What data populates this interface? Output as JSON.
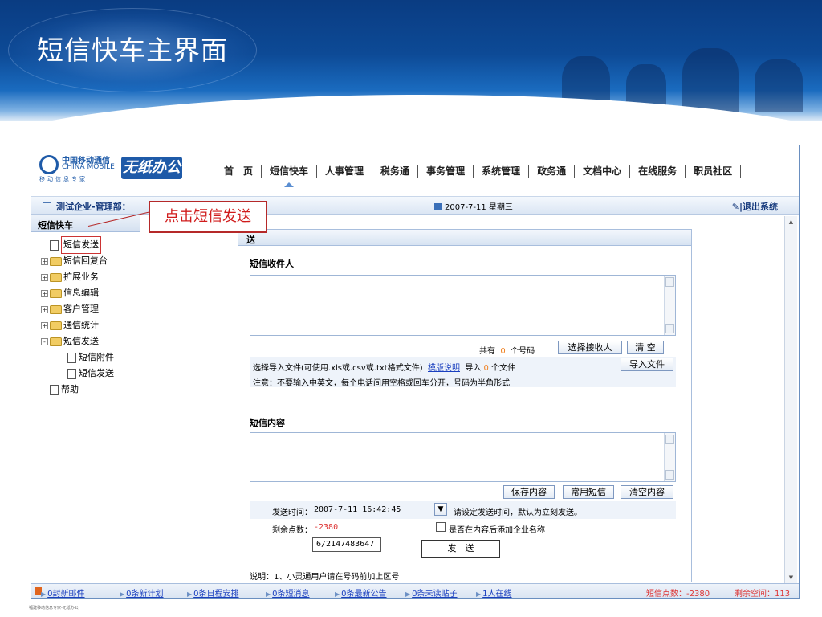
{
  "slide": {
    "title": "短信快车主界面",
    "footer": "福建移动信息专家-无纸办公"
  },
  "callout": {
    "text": "点击短信发送"
  },
  "header": {
    "brand_cn": "中国移动通信",
    "brand_en": "CHINA MOBILE",
    "brand_sub": "移动信息专家",
    "product": "无纸办公",
    "nav": [
      "首　页",
      "短信快车",
      "人事管理",
      "税务通",
      "事务管理",
      "系统管理",
      "政务通",
      "文档中心",
      "在线服务",
      "职员社区"
    ],
    "active_nav": "短信快车"
  },
  "infobar": {
    "company": "测试企业-管理部：",
    "date": "2007-7-11 星期三",
    "logout": "|退出系统"
  },
  "sidebar": {
    "title": "短信快车",
    "items": [
      {
        "label": "短信发送",
        "type": "doc",
        "level": 0,
        "selected": true
      },
      {
        "label": "短信回复台",
        "type": "folder",
        "level": 0,
        "toggle": "+"
      },
      {
        "label": "扩展业务",
        "type": "folder",
        "level": 0,
        "toggle": "+"
      },
      {
        "label": "信息编辑",
        "type": "folder",
        "level": 0,
        "toggle": "+"
      },
      {
        "label": "客户管理",
        "type": "folder",
        "level": 0,
        "toggle": "+"
      },
      {
        "label": "通信统计",
        "type": "folder",
        "level": 0,
        "toggle": "+"
      },
      {
        "label": "短信发送",
        "type": "folder",
        "level": 0,
        "toggle": "-"
      },
      {
        "label": "短信附件",
        "type": "doc",
        "level": 1
      },
      {
        "label": "短信发送",
        "type": "doc",
        "level": 1
      },
      {
        "label": "帮助",
        "type": "doc",
        "level": 0
      }
    ]
  },
  "panel": {
    "title": "送",
    "recipients": {
      "title": "短信收件人",
      "total_prefix": "共有",
      "total_count": "0",
      "total_suffix": "个号码",
      "choose_btn": "选择接收人",
      "clear_btn": "清 空"
    },
    "import": {
      "label": "选择导入文件(可使用.xls或.csv或.txt格式文件)",
      "template_link": "模版说明",
      "import_prefix": "导入",
      "import_count": "0",
      "import_suffix": "个文件",
      "import_btn": "导入文件"
    },
    "note": "注意：不要输入中英文，每个电话间用空格或回车分开，号码为半角形式",
    "content": {
      "title": "短信内容",
      "save_btn": "保存内容",
      "common_btn": "常用短信",
      "clear_btn": "清空内容"
    },
    "send_time": {
      "label": "发送时间：",
      "value": "2007-7-11 16:42:45",
      "hint": "请设定发送时间，默认为立刻发送。"
    },
    "points": {
      "label": "剩余点数：",
      "value": "-2380",
      "counter": "6/2147483647",
      "checkbox_label": "是否在内容后添加企业名称"
    },
    "send_btn": "发　送",
    "footnote": "说明：1、小灵通用户请在号码前加上区号"
  },
  "status": {
    "items": [
      "0封新邮件",
      "0条新计划",
      "0条日程安排",
      "0条短消息",
      "0条最新公告",
      "0条未读贴子",
      "1人在线"
    ],
    "points": "短信点数：-2380",
    "space": "剩余空间：113"
  }
}
